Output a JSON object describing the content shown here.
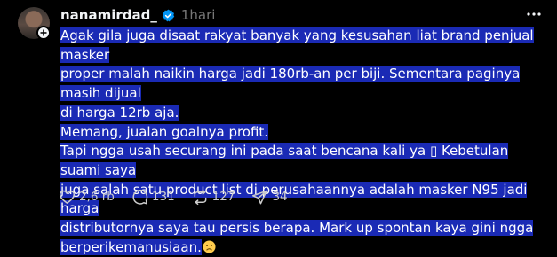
{
  "post": {
    "username": "nanamirdad_",
    "time": "1hari",
    "lines": [
      "Agak gila juga disaat rakyat banyak yang kesusahan liat brand penjual masker",
      "proper malah naikin harga jadi 180rb-an per biji. Sementara paginya masih dijual",
      "di harga 12rb aja.",
      "Memang, jualan goalnya profit.",
      "Tapi ngga usah securang ini pada saat bencana kali ya ▯ Kebetulan suami saya",
      "juga salah satu product list di perusahaannya adalah masker N95 jadi harga",
      "distributornya saya tau persis berapa. Mark up spontan kaya gini ngga",
      "berperikemanusiaan."
    ]
  },
  "actions": {
    "likes": "2,6 rb",
    "comments": "131",
    "reposts": "127",
    "shares": "34"
  },
  "colors": {
    "highlight": "#1a2ab5",
    "verified": "#0095f6"
  },
  "icons": [
    "verified-badge-icon",
    "more-icon",
    "plus-icon",
    "frown-emoji-icon",
    "heart-icon",
    "comment-icon",
    "repost-icon",
    "share-icon"
  ]
}
